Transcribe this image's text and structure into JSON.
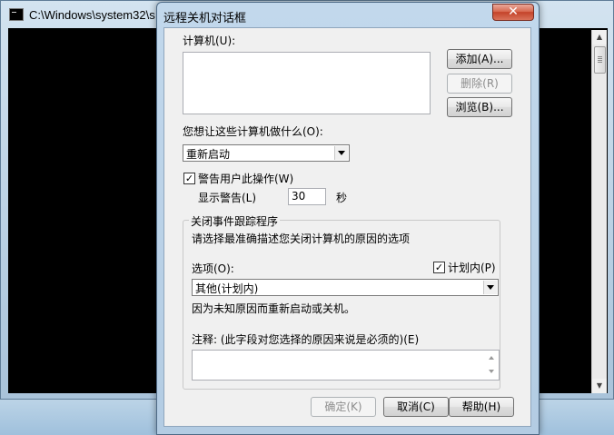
{
  "console": {
    "title": "C:\\Windows\\system32\\s",
    "scroll_up": "▲",
    "scroll_down": "▼"
  },
  "dialog": {
    "title": "远程关机对话框",
    "close_glyph": "✕",
    "computers_label": "计算机(U):",
    "add_button": "添加(A)...",
    "remove_button": "删除(R)",
    "browse_button": "浏览(B)...",
    "action_label": "您想让这些计算机做什么(O):",
    "action_value": "重新启动",
    "warn_checkbox_label": "警告用户此操作(W)",
    "warn_checked": true,
    "display_warning_label": "显示警告(L)",
    "warning_seconds": "30",
    "seconds_unit": "秒",
    "tracker": {
      "group_title": "关闭事件跟踪程序",
      "instruction": "请选择最准确描述您关闭计算机的原因的选项",
      "option_label": "选项(O):",
      "planned_label": "计划内(P)",
      "planned_checked": true,
      "option_value": "其他(计划内)",
      "option_description": "因为未知原因而重新启动或关机。",
      "comment_label": "注释: (此字段对您选择的原因来说是必须的)(E)",
      "comment_value": ""
    },
    "ok_button": "确定(K)",
    "cancel_button": "取消(C)",
    "help_button": "帮助(H)"
  }
}
